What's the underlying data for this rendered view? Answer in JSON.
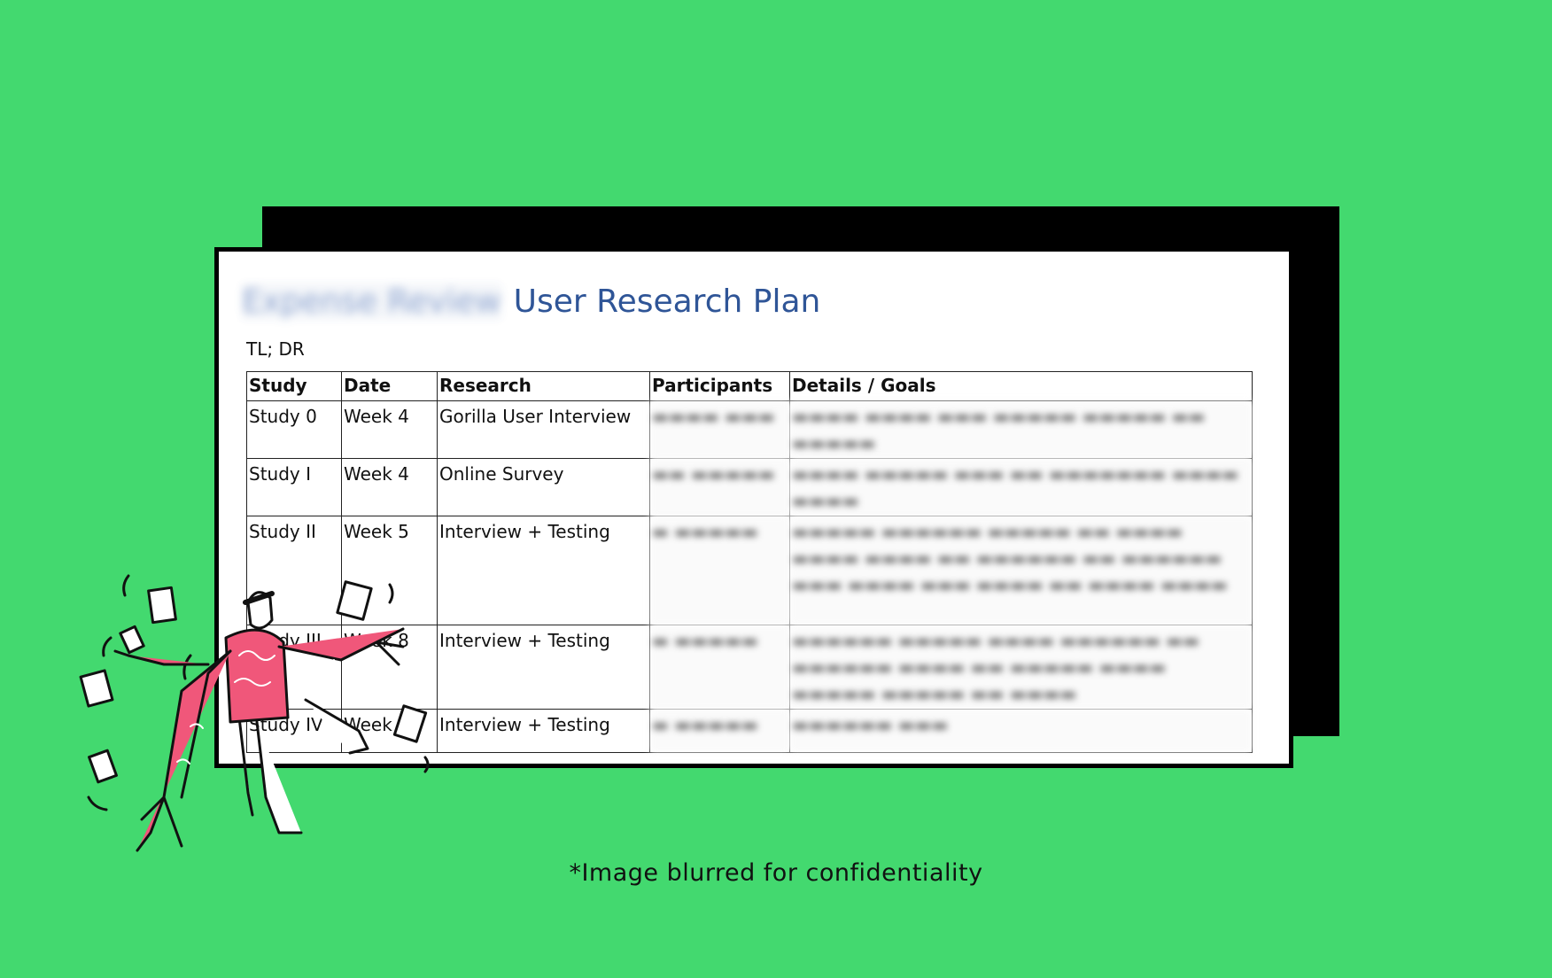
{
  "document": {
    "title_blurred": "Expense Review",
    "title": "User Research Plan",
    "subtitle": "TL; DR"
  },
  "table": {
    "headers": [
      "Study",
      "Date",
      "Research",
      "Participants",
      "Details / Goals"
    ],
    "rows": [
      {
        "study": "Study 0",
        "date": "Week 4",
        "research": "Gorilla User Interview"
      },
      {
        "study": "Study I",
        "date": "Week 4",
        "research": "Online Survey"
      },
      {
        "study": "Study II",
        "date": "Week 5",
        "research": "Interview + Testing"
      },
      {
        "study": "Study III",
        "date": "Week 8",
        "research": "Interview + Testing"
      },
      {
        "study": "Study IV",
        "date": "Week 9",
        "research": "Interview + Testing"
      }
    ]
  },
  "caption": "*Image blurred for confidentiality",
  "colors": {
    "background": "#43d96f",
    "title": "#2f5597",
    "character_shirt": "#f0577a"
  },
  "illustration": {
    "icon": "juggling-person-with-papers"
  }
}
